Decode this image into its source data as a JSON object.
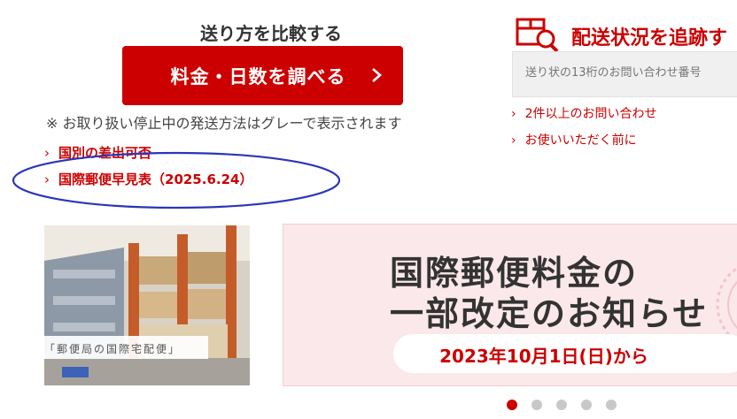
{
  "compare": {
    "heading": "送り方を比較する",
    "button_label": "料金・日数を調べる",
    "notice": "※ お取り扱い停止中の発送方法はグレーで表示されます",
    "links": [
      "国別の差出可否",
      "国際郵便早見表（2025.6.24）"
    ]
  },
  "tracking": {
    "heading": "配送状況を追跡す",
    "input_placeholder": "送り状の13桁のお問い合わせ番号",
    "links": [
      "2件以上のお問い合わせ",
      "お使いいただく前に"
    ]
  },
  "banners": {
    "photo_caption": "「郵便局の国際宅配便」",
    "promo_line1": "国際郵便料金の",
    "promo_line2": "一部改定のお知らせ",
    "promo_date": "2023年10月1日(日)から"
  },
  "carousel": {
    "count": 5,
    "active_index": 0
  },
  "colors": {
    "accent": "#cc0000",
    "annotation_oval": "#2a35b8",
    "promo_bg": "#fbe8ea"
  }
}
